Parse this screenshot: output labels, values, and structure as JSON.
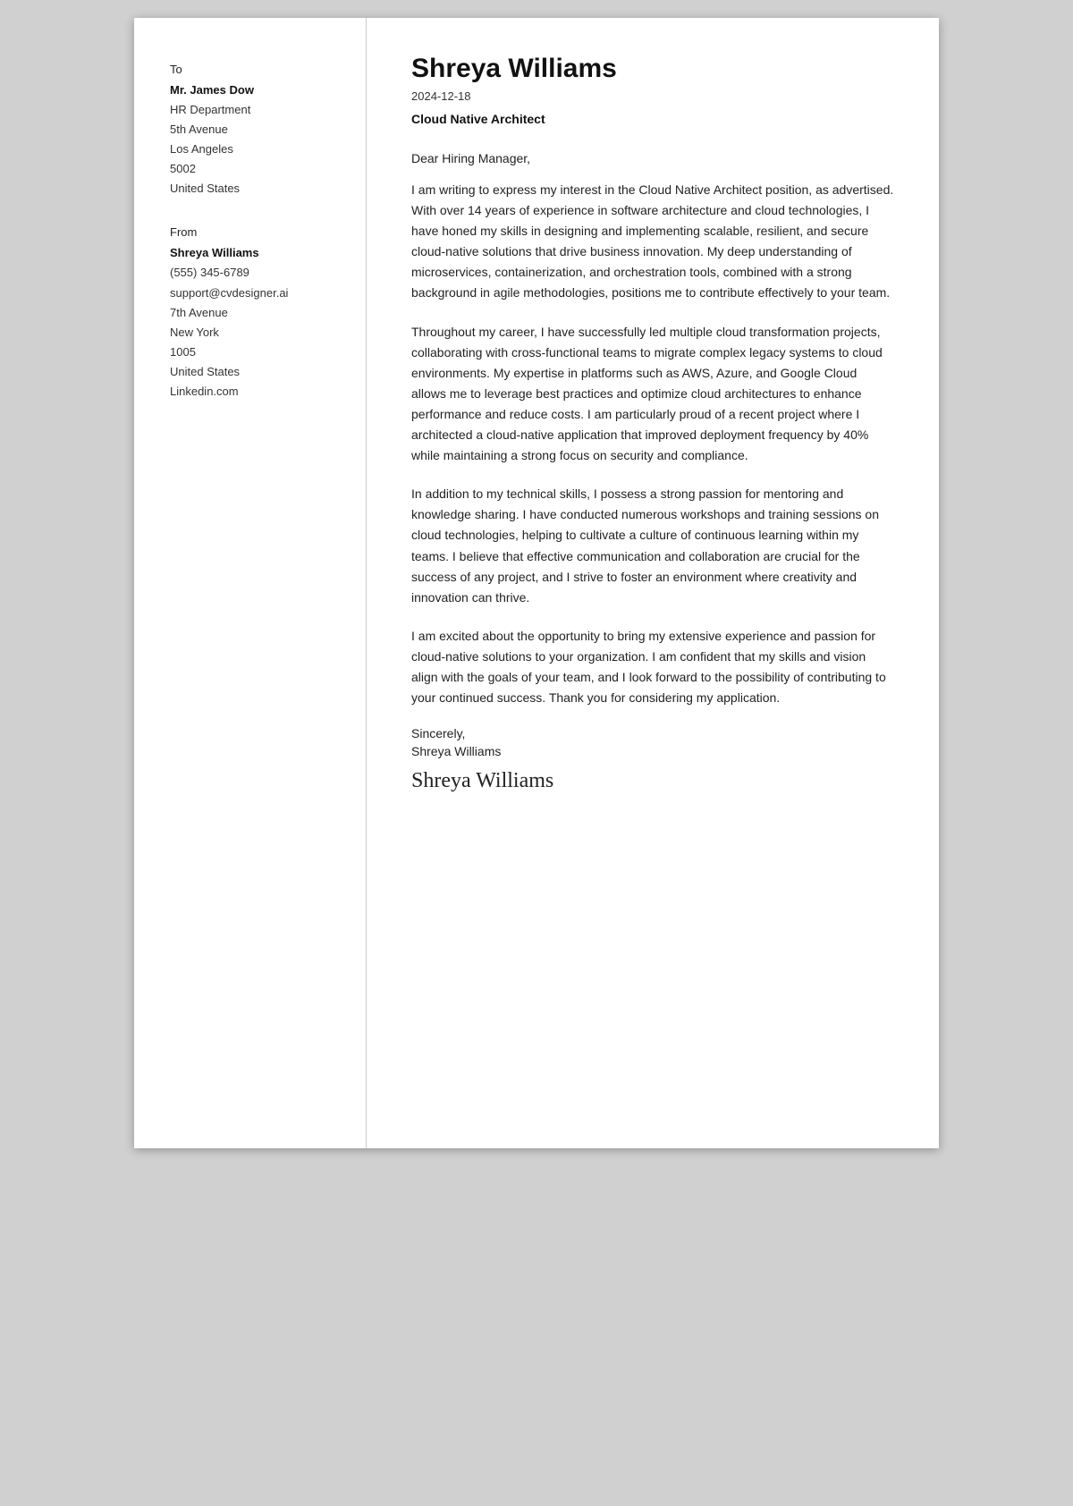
{
  "sidebar": {
    "to_label": "To",
    "recipient_name": "Mr. James Dow",
    "recipient_department": "HR Department",
    "recipient_street": "5th Avenue",
    "recipient_city": "Los Angeles",
    "recipient_zip": "5002",
    "recipient_country": "United States",
    "from_label": "From",
    "sender_name": "Shreya Williams",
    "sender_phone": "(555) 345-6789",
    "sender_email": "support@cvdesigner.ai",
    "sender_street": "7th Avenue",
    "sender_city": "New York",
    "sender_zip": "1005",
    "sender_country": "United States",
    "sender_linkedin": "Linkedin.com"
  },
  "main": {
    "applicant_name": "Shreya Williams",
    "date": "2024-12-18",
    "job_title": "Cloud Native Architect",
    "salutation": "Dear Hiring Manager,",
    "paragraph1": "I am writing to express my interest in the Cloud Native Architect position, as advertised. With over 14 years of experience in software architecture and cloud technologies, I have honed my skills in designing and implementing scalable, resilient, and secure cloud-native solutions that drive business innovation. My deep understanding of microservices, containerization, and orchestration tools, combined with a strong background in agile methodologies, positions me to contribute effectively to your team.",
    "paragraph2": "Throughout my career, I have successfully led multiple cloud transformation projects, collaborating with cross-functional teams to migrate complex legacy systems to cloud environments. My expertise in platforms such as AWS, Azure, and Google Cloud allows me to leverage best practices and optimize cloud architectures to enhance performance and reduce costs. I am particularly proud of a recent project where I architected a cloud-native application that improved deployment frequency by 40% while maintaining a strong focus on security and compliance.",
    "paragraph3": "In addition to my technical skills, I possess a strong passion for mentoring and knowledge sharing. I have conducted numerous workshops and training sessions on cloud technologies, helping to cultivate a culture of continuous learning within my teams. I believe that effective communication and collaboration are crucial for the success of any project, and I strive to foster an environment where creativity and innovation can thrive.",
    "paragraph4": "I am excited about the opportunity to bring my extensive experience and passion for cloud-native solutions to your organization. I am confident that my skills and vision align with the goals of your team, and I look forward to the possibility of contributing to your continued success. Thank you for considering my application.",
    "closing": "Sincerely,",
    "closing_name": "Shreya Williams",
    "signature": "Shreya Williams"
  }
}
